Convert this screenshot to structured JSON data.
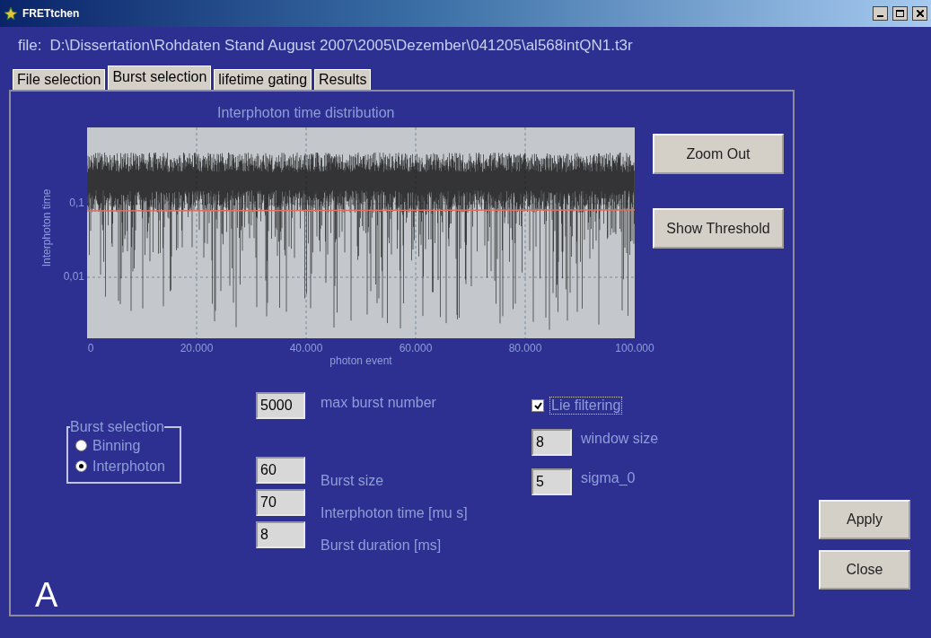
{
  "window": {
    "title": "FRETtchen"
  },
  "file_line": {
    "label": "file:",
    "path": "D:\\Dissertation\\Rohdaten Stand August 2007\\2005\\Dezember\\041205\\al568intQN1.t3r"
  },
  "tabs": [
    {
      "label": "File selection",
      "selected": false
    },
    {
      "label": "Burst selection",
      "selected": true
    },
    {
      "label": "lifetime gating",
      "selected": false
    },
    {
      "label": "Results",
      "selected": false
    }
  ],
  "plot": {
    "title": "Interphoton time distribution",
    "ylabel": "Interphoton time",
    "xlabel": "photon event",
    "yticks": [
      "0,1",
      "0,01"
    ],
    "xticks": [
      "0",
      "20.000",
      "40.000",
      "60.000",
      "80.000",
      "100.000"
    ]
  },
  "plot_buttons": [
    "Zoom Out",
    "Show Threshold"
  ],
  "burst_selection": {
    "title": "Burst selection",
    "options": [
      {
        "label": "Binning",
        "selected": false
      },
      {
        "label": "Interphoton",
        "selected": true
      }
    ]
  },
  "max_burst": {
    "value": "5000",
    "label": "max burst number"
  },
  "burst_params": [
    {
      "value": "60",
      "label": "Burst size"
    },
    {
      "value": "70",
      "label": "Interphoton time [mu s]"
    },
    {
      "value": "8",
      "label": "Burst duration [ms]"
    }
  ],
  "filter": {
    "label": "Lie filtering",
    "checked": true
  },
  "filter_params": [
    {
      "value": "8",
      "label": "window size"
    },
    {
      "value": "5",
      "label": "sigma_0"
    }
  ],
  "buttons": [
    "Apply",
    "Close"
  ],
  "panel_label": "A"
}
